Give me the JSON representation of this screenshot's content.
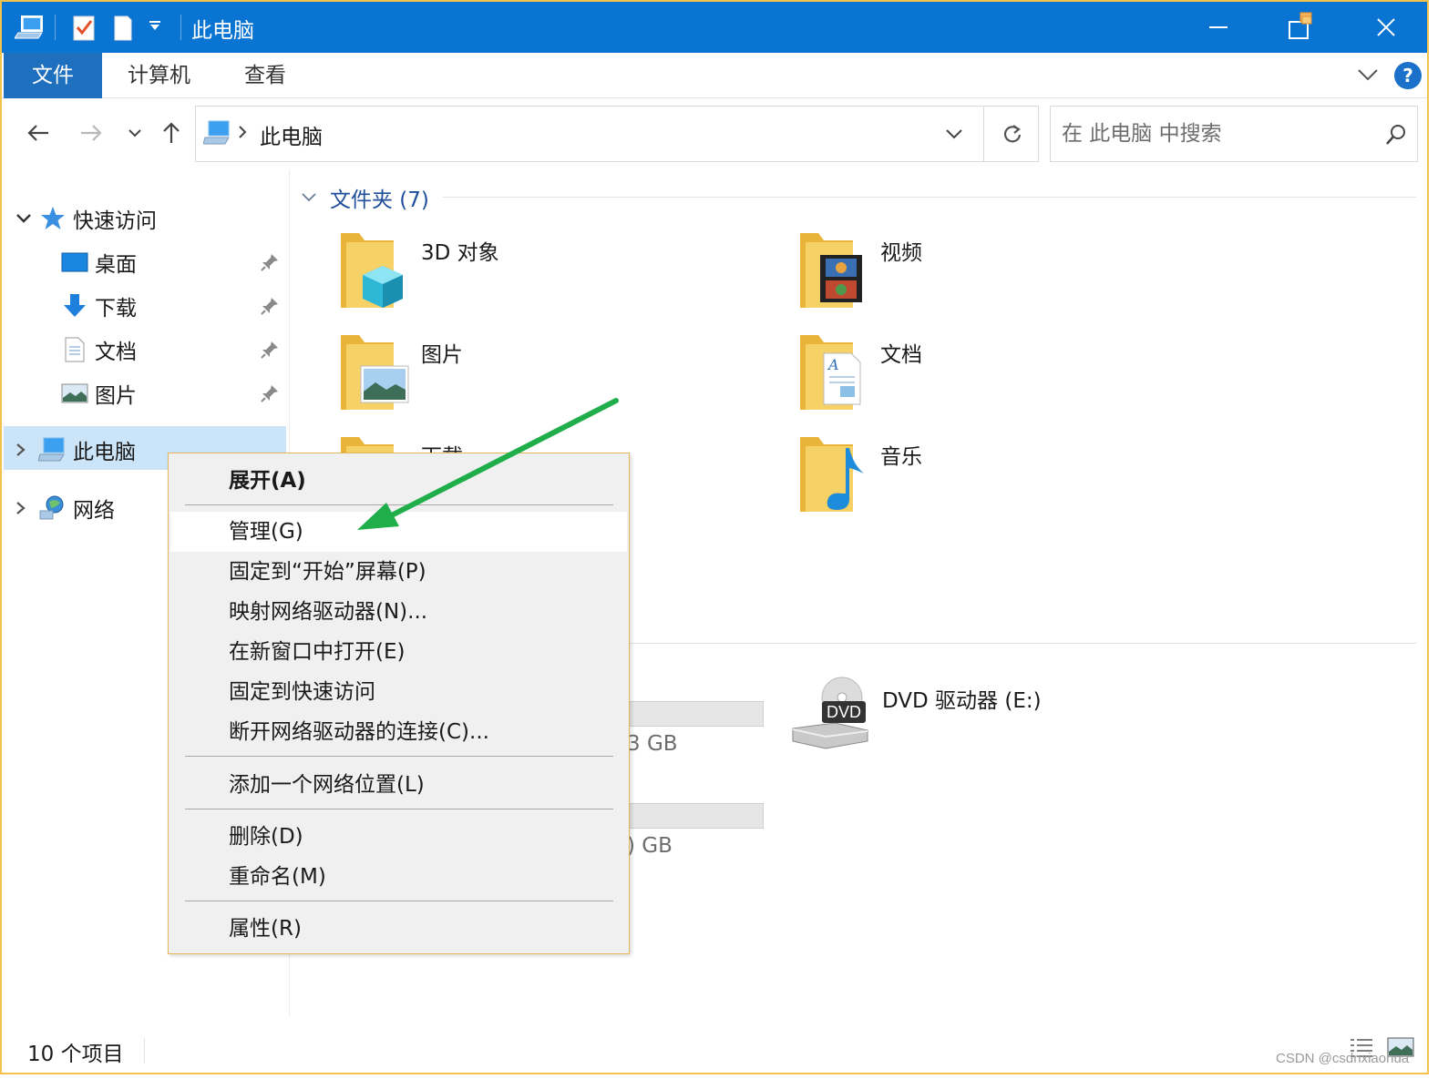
{
  "window": {
    "title": "此电脑",
    "accent": "#0a74d3"
  },
  "ribbon": {
    "tabs": [
      "文件",
      "计算机",
      "查看"
    ],
    "help": "?"
  },
  "nav": {
    "address": "此电脑",
    "search_placeholder": "在 此电脑 中搜索"
  },
  "sidebar": {
    "quick_access": "快速访问",
    "items": [
      {
        "label": "桌面",
        "icon": "desktop-icon"
      },
      {
        "label": "下载",
        "icon": "download-icon"
      },
      {
        "label": "文档",
        "icon": "document-icon"
      },
      {
        "label": "图片",
        "icon": "picture-icon"
      }
    ],
    "this_pc": "此电脑",
    "network": "网络"
  },
  "main": {
    "folders_header": "文件夹 (7)",
    "folders": [
      {
        "label": "3D 对象",
        "icon": "3d-objects-folder-icon"
      },
      {
        "label": "视频",
        "icon": "video-folder-icon"
      },
      {
        "label": "图片",
        "icon": "pictures-folder-icon"
      },
      {
        "label": "文档",
        "icon": "documents-folder-icon"
      },
      {
        "label": "下载",
        "icon": "downloads-folder-icon"
      },
      {
        "label": "音乐",
        "icon": "music-folder-icon"
      }
    ],
    "drive_sizes": [
      "3 GB",
      ") GB"
    ],
    "dvd": {
      "label": "DVD 驱动器 (E:)",
      "badge": "DVD"
    }
  },
  "context_menu": {
    "items": [
      "展开(A)",
      "管理(G)",
      "固定到“开始”屏幕(P)",
      "映射网络驱动器(N)...",
      "在新窗口中打开(E)",
      "固定到快速访问",
      "断开网络驱动器的连接(C)...",
      "添加一个网络位置(L)",
      "删除(D)",
      "重命名(M)",
      "属性(R)"
    ]
  },
  "status": {
    "count": "10 个项目",
    "watermark": "CSDN @csdnxiaohua"
  },
  "colors": {
    "arrow": "#1fae4a",
    "selection": "#cce4f7",
    "folder": "#f6c94a"
  }
}
